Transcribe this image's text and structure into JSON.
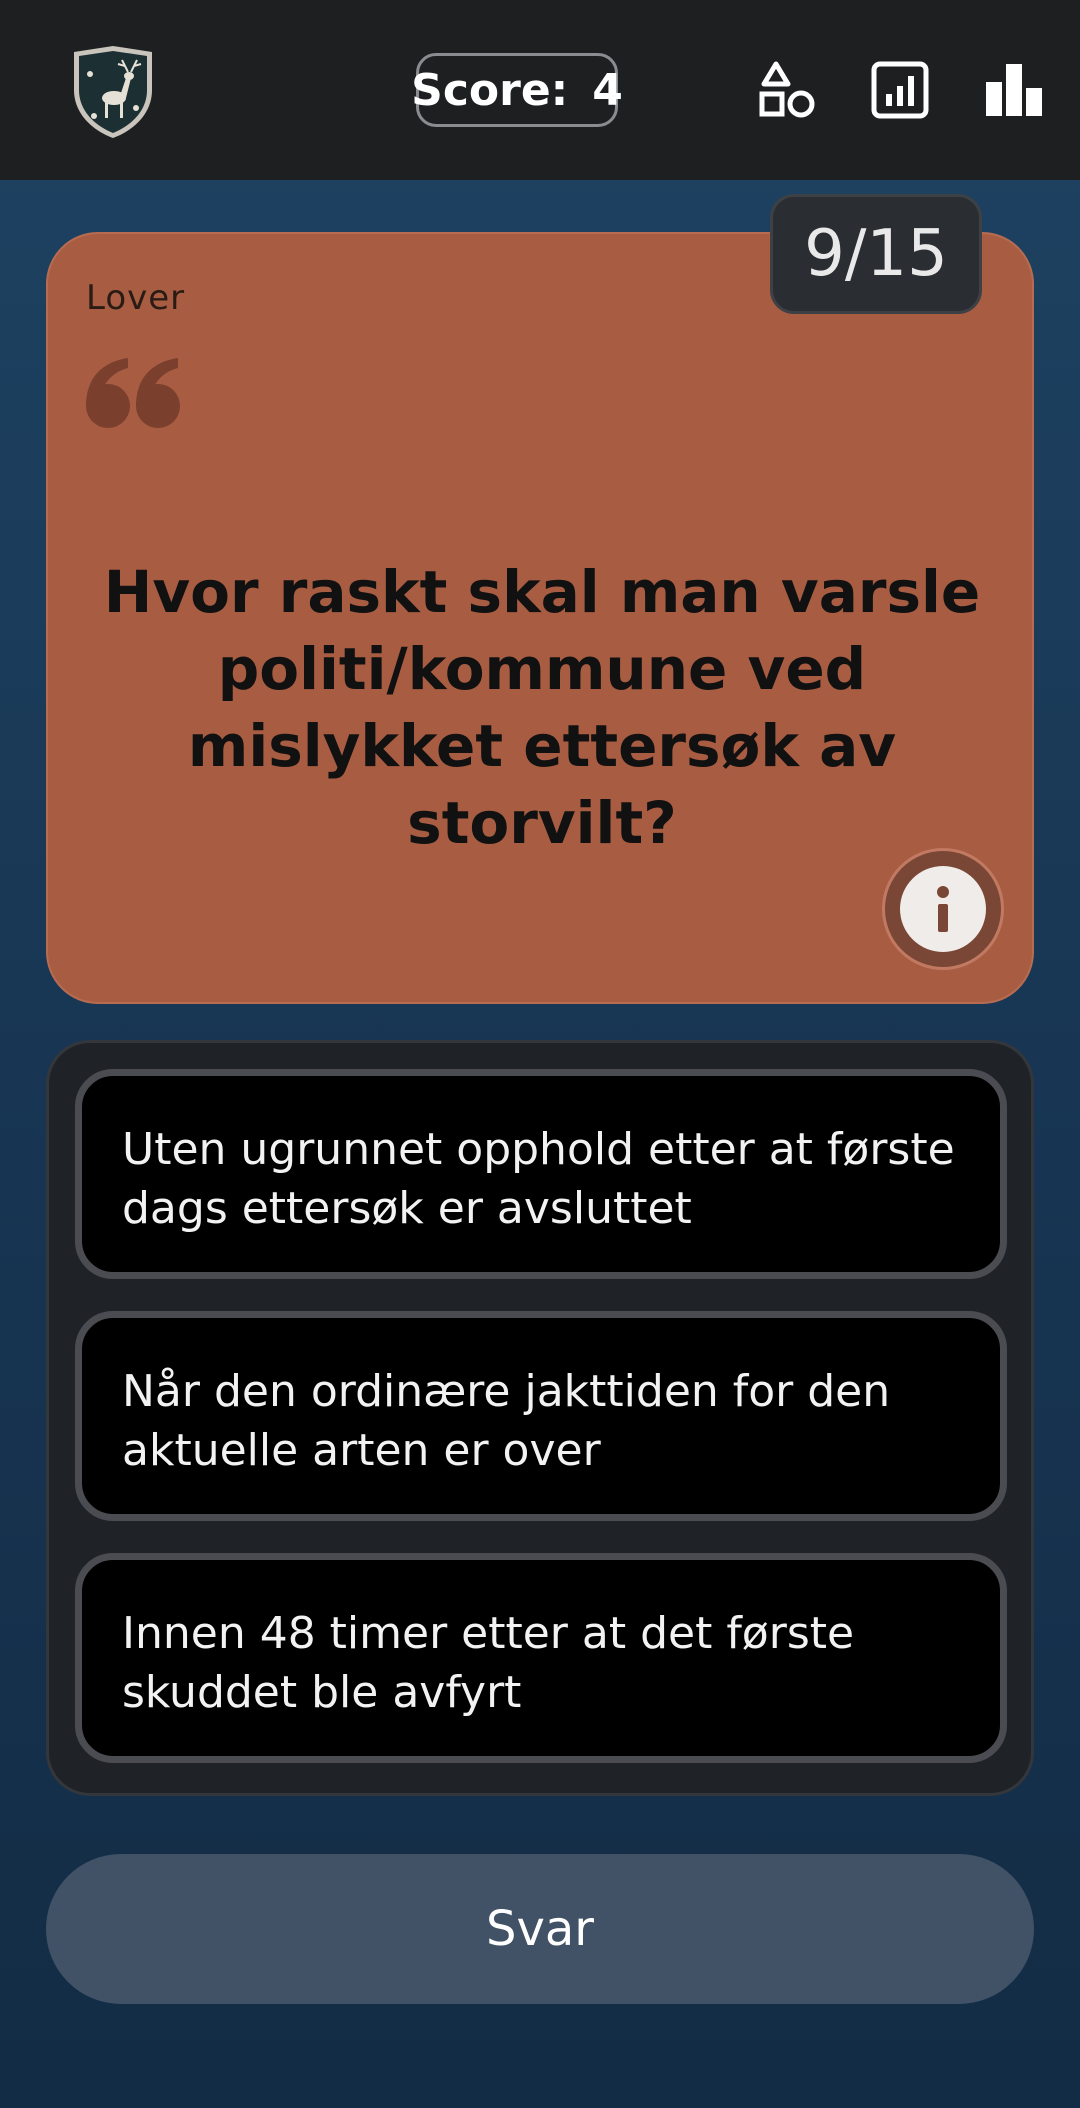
{
  "header": {
    "score_label": "Score:",
    "score_value": "4",
    "icons": [
      "deer-crest-logo",
      "shapes-icon",
      "report-chart-icon",
      "bar-chart-icon"
    ]
  },
  "question": {
    "counter": "9/15",
    "category": "Lover",
    "text": "Hvor raskt skal man varsle politi/kommune ved mislykket ettersøk av storvilt?",
    "card_color": "#a85d43"
  },
  "options": [
    "Uten ugrunnet opphold etter at første dags ettersøk er avsluttet",
    "Når den ordinære jakttiden for den aktuelle arten er over",
    "Innen 48 timer etter at det første skuddet ble avfyrt"
  ],
  "submit_label": "Svar"
}
